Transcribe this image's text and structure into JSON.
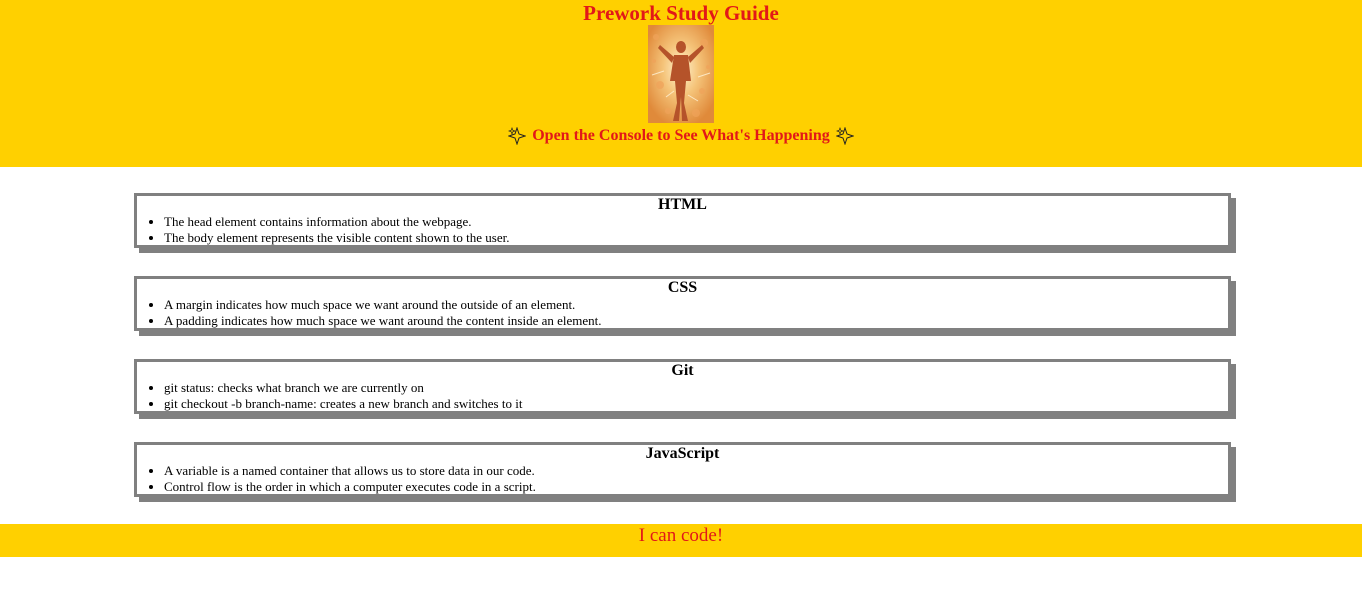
{
  "header": {
    "title": "Prework Study Guide",
    "console_text": "Open the Console to See What's Happening",
    "sparkle_icon": "sparkles-icon",
    "accent_color": "#e21818",
    "background_color": "#ffd000"
  },
  "sections": [
    {
      "title": "HTML",
      "items": [
        "The head element contains information about the webpage.",
        "The body element represents the visible content shown to the user."
      ]
    },
    {
      "title": "CSS",
      "items": [
        "A margin indicates how much space we want around the outside of an element.",
        "A padding indicates how much space we want around the content inside an element."
      ]
    },
    {
      "title": "Git",
      "items": [
        "git status: checks what branch we are currently on",
        "git checkout -b branch-name: creates a new branch and switches to it"
      ]
    },
    {
      "title": "JavaScript",
      "items": [
        "A variable is a named container that allows us to store data in our code.",
        "Control flow is the order in which a computer executes code in a script."
      ]
    }
  ],
  "footer": {
    "text": "I can code!"
  }
}
